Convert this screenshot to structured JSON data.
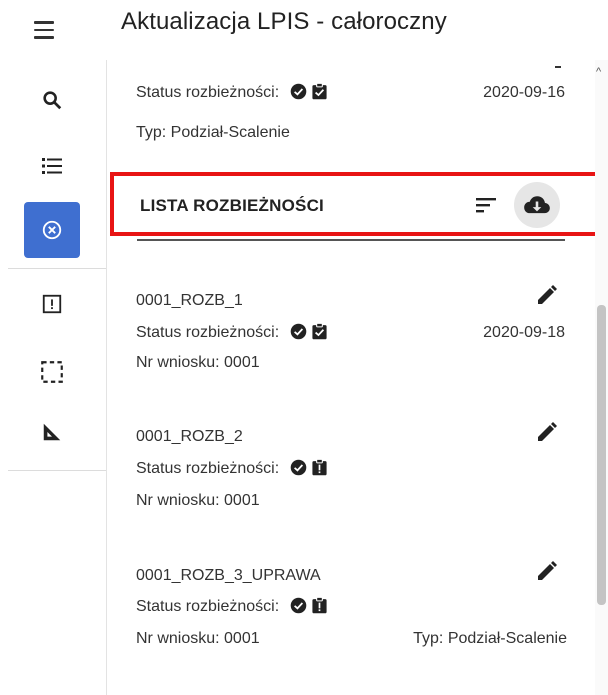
{
  "header": {
    "title": "Aktualizacja LPIS - całoroczny"
  },
  "top_item": {
    "status_label": "Status rozbieżności:",
    "date": "2020-09-16",
    "type": "Typ: Podział-Scalenie"
  },
  "list": {
    "title": "LISTA ROZBIEŻNOŚCI",
    "items": [
      {
        "name": "0001_ROZB_1",
        "status_label": "Status rozbieżności:",
        "date": "2020-09-18",
        "application": "Nr wniosku: 0001",
        "type": ""
      },
      {
        "name": "0001_ROZB_2",
        "status_label": "Status rozbieżności:",
        "date": "",
        "application": "Nr wniosku: 0001",
        "type": ""
      },
      {
        "name": "0001_ROZB_3_UPRAWA",
        "status_label": "Status rozbieżności:",
        "date": "",
        "application": "Nr wniosku: 0001",
        "type": "Typ: Podział-Scalenie"
      }
    ]
  },
  "colors": {
    "active_rail": "#3f6fd0",
    "highlight_border": "#e81414"
  },
  "icons": [
    "menu-icon",
    "search-icon",
    "list-icon",
    "cancel-circle-icon",
    "alert-box-icon",
    "selection-icon",
    "measure-icon",
    "check-circle-icon",
    "clipboard-check-icon",
    "clipboard-alert-icon",
    "sort-icon",
    "cloud-download-icon",
    "edit-icon"
  ]
}
